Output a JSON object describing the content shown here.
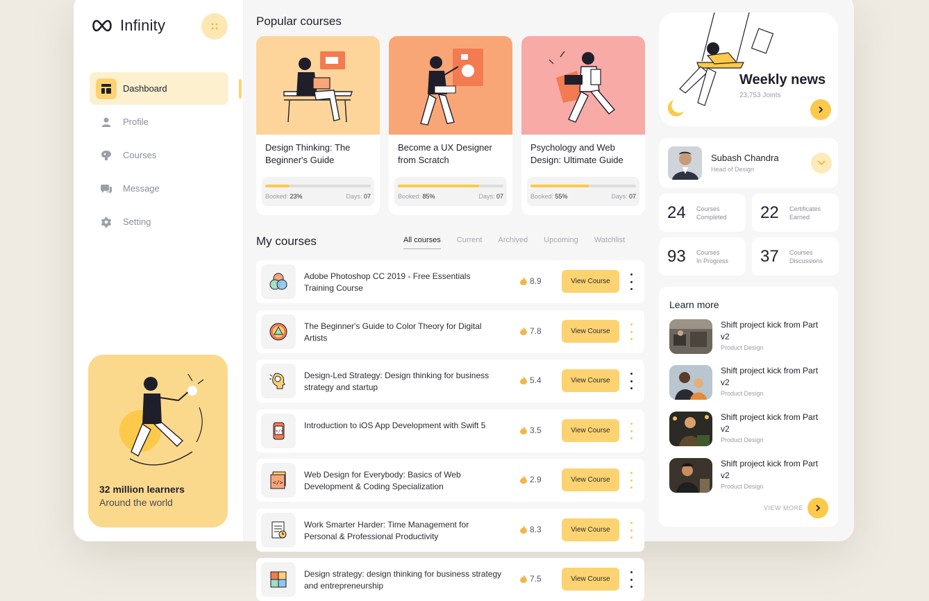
{
  "app": {
    "name": "Infinity"
  },
  "sidebar": {
    "items": [
      {
        "label": "Dashboard",
        "icon": "dashboard-icon",
        "active": true
      },
      {
        "label": "Profile",
        "icon": "user-icon",
        "active": false
      },
      {
        "label": "Courses",
        "icon": "courses-icon",
        "active": false
      },
      {
        "label": "Message",
        "icon": "message-icon",
        "active": false
      },
      {
        "label": "Setting",
        "icon": "gear-icon",
        "active": false
      }
    ],
    "promo": {
      "title": "32 million learners",
      "subtitle": "Around the world"
    }
  },
  "popular": {
    "title": "Popular courses",
    "cards": [
      {
        "title": "Design Thinking: The Beginner's Guide",
        "booked_label": "Booked:",
        "booked": "23%",
        "progress": 0.23,
        "days_label": "Days:",
        "days": "07",
        "bg": "#fdd59a"
      },
      {
        "title": "Become a UX Designer from Scratch",
        "booked_label": "Booked:",
        "booked": "85%",
        "progress": 0.77,
        "days_label": "Days:",
        "days": "07",
        "bg": "#f9a677"
      },
      {
        "title": "Psychology and Web Design: Ultimate Guide",
        "booked_label": "Booked:",
        "booked": "55%",
        "progress": 0.55,
        "days_label": "Days:",
        "days": "07",
        "bg": "#f8aaa7"
      }
    ]
  },
  "my_courses": {
    "title": "My courses",
    "tabs": [
      "All courses",
      "Current",
      "Archived",
      "Upcoming",
      "Watchlist"
    ],
    "button_label": "View Course",
    "rows": [
      {
        "title": "Adobe Photoshop CC 2019 - Free Essentials Training Course",
        "rating": "8.9",
        "icon": "rgb-icon"
      },
      {
        "title": "The Beginner's Guide to Color Theory for Digital Artists",
        "rating": "7.8",
        "icon": "color-wheel-icon"
      },
      {
        "title": "Design-Led Strategy: Design thinking for business strategy and startup",
        "rating": "5.4",
        "icon": "head-bulb-icon"
      },
      {
        "title": "Introduction to iOS App Development with Swift 5",
        "rating": "3.5",
        "icon": "mobile-app-icon"
      },
      {
        "title": "Web Design for Everybody: Basics of Web Development & Coding Specialization",
        "rating": "2.9",
        "icon": "code-window-icon"
      },
      {
        "title": "Work Smarter Harder: Time Management for Personal & Professional Productivity",
        "rating": "8.3",
        "icon": "clipboard-clock-icon"
      },
      {
        "title": "Design strategy: design thinking for business strategy and entrepreneurship",
        "rating": "7.5",
        "icon": "puzzle-icon"
      }
    ]
  },
  "weekly": {
    "title": "Weekly news",
    "subtitle": "23,753 Joints"
  },
  "profile": {
    "name": "Subash Chandra",
    "role": "Head of Design"
  },
  "stats": [
    {
      "value": "24",
      "label_1": "Courses",
      "label_2": "Completed"
    },
    {
      "value": "22",
      "label_1": "Certificates",
      "label_2": "Earned"
    },
    {
      "value": "93",
      "label_1": "Courses",
      "label_2": "In Progress"
    },
    {
      "value": "37",
      "label_1": "Courses",
      "label_2": "Discussions"
    }
  ],
  "learn_more": {
    "title": "Learn more",
    "items": [
      {
        "title": "Shift project kick from Part v2",
        "category": "Product Design"
      },
      {
        "title": "Shift project kick from Part v2",
        "category": "Product Design"
      },
      {
        "title": "Shift project kick from Part v2",
        "category": "Product Design"
      },
      {
        "title": "Shift project kick from Part v2",
        "category": "Product Design"
      }
    ],
    "view_more": "VIEW MORE"
  },
  "colors": {
    "accent": "#fcd370",
    "accent_strong": "#fcc94a",
    "promo_bg": "#fbd98c"
  }
}
